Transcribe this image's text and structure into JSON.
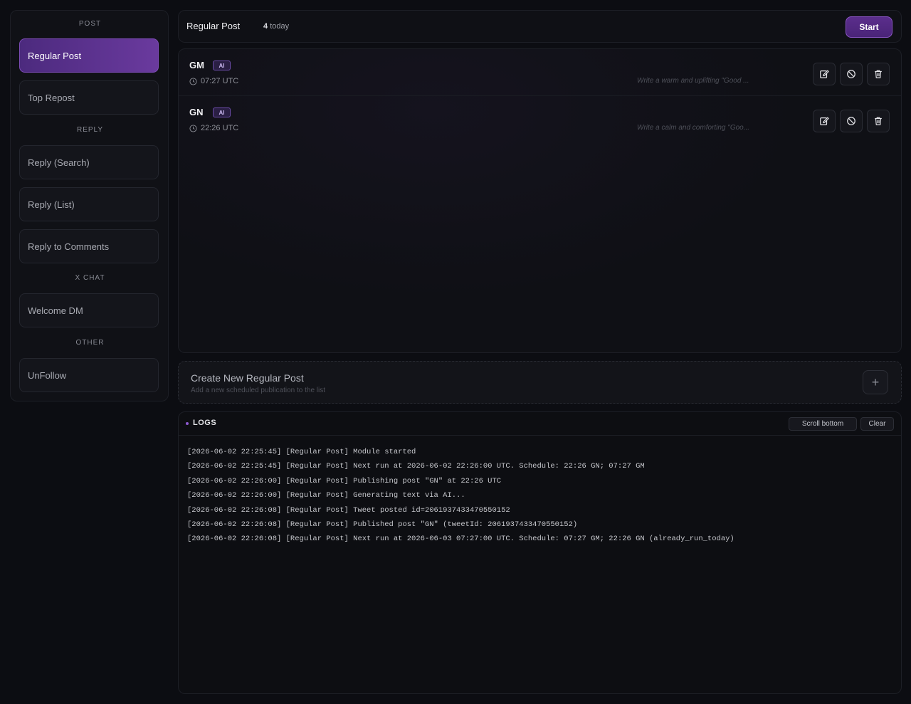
{
  "sidebar": {
    "sections": [
      {
        "label": "POST",
        "items": [
          {
            "label": "Regular Post",
            "active": true
          },
          {
            "label": "Top Repost",
            "active": false
          }
        ]
      },
      {
        "label": "REPLY",
        "items": [
          {
            "label": "Reply (Search)",
            "active": false
          },
          {
            "label": "Reply (List)",
            "active": false
          },
          {
            "label": "Reply to Comments",
            "active": false
          }
        ]
      },
      {
        "label": "X CHAT",
        "items": [
          {
            "label": "Welcome DM",
            "active": false
          }
        ]
      },
      {
        "label": "OTHER",
        "items": [
          {
            "label": "UnFollow",
            "active": false
          }
        ]
      }
    ]
  },
  "header": {
    "title": "Regular Post",
    "count_value": "4",
    "count_suffix": "today",
    "start_label": "Start"
  },
  "posts": [
    {
      "name": "GM",
      "badge": "AI",
      "time": "07:27 UTC",
      "prompt": "Write a warm and uplifting \"Good ..."
    },
    {
      "name": "GN",
      "badge": "AI",
      "time": "22:26 UTC",
      "prompt": "Write a calm and comforting \"Goo..."
    }
  ],
  "create": {
    "title": "Create New Regular Post",
    "subtitle": "Add a new scheduled publication to the list",
    "plus": "+"
  },
  "logs": {
    "title": "LOGS",
    "scroll_label": "Scroll bottom",
    "clear_label": "Clear",
    "lines": [
      "[2026-06-02 22:25:45] [Regular Post] Module started",
      "[2026-06-02 22:25:45] [Regular Post] Next run at 2026-06-02 22:26:00 UTC. Schedule: 22:26 GN; 07:27 GM",
      "[2026-06-02 22:26:00] [Regular Post] Publishing post \"GN\" at 22:26 UTC",
      "[2026-06-02 22:26:00] [Regular Post] Generating text via AI...",
      "[2026-06-02 22:26:08] [Regular Post] Tweet posted id=2061937433470550152",
      "[2026-06-02 22:26:08] [Regular Post] Published post \"GN\" (tweetId: 2061937433470550152)",
      "[2026-06-02 22:26:08] [Regular Post] Next run at 2026-06-03 07:27:00 UTC. Schedule: 07:27 GM; 22:26 GN (already_run_today)"
    ]
  },
  "colors": {
    "accent": "#6a3a9e",
    "background": "#0c0d12",
    "panel": "#101116"
  },
  "icons": [
    "clock-icon",
    "edit-icon",
    "disable-icon",
    "trash-icon",
    "plus-icon"
  ]
}
